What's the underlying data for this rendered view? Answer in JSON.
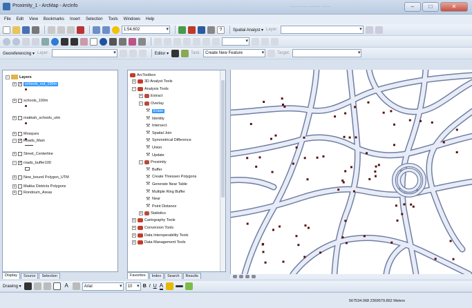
{
  "window": {
    "title": "Proximity_1 - ArcMap - ArcInfo",
    "minimize": "–",
    "maximize": "□",
    "close": "✕",
    "blurred_tabs": "....... ....... .......... ........"
  },
  "menu": [
    "File",
    "Edit",
    "View",
    "Bookmarks",
    "Insert",
    "Selection",
    "Tools",
    "Windows",
    "Help"
  ],
  "toolbar1": {
    "scale": "1:54,602",
    "spatial_analyst": "Spatial Analyst ▾",
    "layer_combo": ""
  },
  "toolbar3": {
    "georeferencing": "Georeferencing ▾",
    "layer": "Layer:",
    "editor": "Editor ▾",
    "construct": "Create New Feature",
    "task": "Task:",
    "target": "Target:"
  },
  "toc": {
    "title": "Layers",
    "layers": [
      {
        "label": "schools_out_100m",
        "checked": true,
        "selected": true
      },
      {
        "label": "schools_100m",
        "checked": false
      },
      {
        "label": "makkah_schools_utm",
        "checked": false
      },
      {
        "label": "Mosques",
        "checked": false
      },
      {
        "label": "Roads_Main",
        "checked": true
      },
      {
        "label": "Street_Centerline",
        "checked": false
      },
      {
        "label": "roads_buffer100",
        "checked": true
      },
      {
        "label": "New_bound Polygon_UTM",
        "checked": false
      },
      {
        "label": "Makka Districts Polygons",
        "checked": false
      },
      {
        "label": "Rondoum_Areas",
        "checked": false
      }
    ],
    "tabs": [
      "Display",
      "Source",
      "Selection"
    ]
  },
  "toolbox": {
    "title": "ArcToolbox",
    "items": [
      {
        "label": "3D Analyst Tools",
        "kind": "toolbox",
        "indent": 0,
        "exp": "+"
      },
      {
        "label": "Analysis Tools",
        "kind": "toolbox",
        "indent": 0,
        "exp": "−"
      },
      {
        "label": "Extract",
        "kind": "toolset",
        "indent": 1,
        "exp": "+"
      },
      {
        "label": "Overlay",
        "kind": "toolset",
        "indent": 1,
        "exp": "−"
      },
      {
        "label": "Erase",
        "kind": "tool",
        "indent": 2,
        "selected": true
      },
      {
        "label": "Identity",
        "kind": "tool",
        "indent": 2
      },
      {
        "label": "Intersect",
        "kind": "tool",
        "indent": 2
      },
      {
        "label": "Spatial Join",
        "kind": "tool",
        "indent": 2
      },
      {
        "label": "Symmetrical Difference",
        "kind": "tool",
        "indent": 2
      },
      {
        "label": "Union",
        "kind": "tool",
        "indent": 2
      },
      {
        "label": "Update",
        "kind": "tool",
        "indent": 2
      },
      {
        "label": "Proximity",
        "kind": "toolset",
        "indent": 1,
        "exp": "−"
      },
      {
        "label": "Buffer",
        "kind": "tool",
        "indent": 2
      },
      {
        "label": "Create Thiessen Polygons",
        "kind": "tool",
        "indent": 2
      },
      {
        "label": "Generate Near Table",
        "kind": "tool",
        "indent": 2
      },
      {
        "label": "Multiple Ring Buffer",
        "kind": "tool",
        "indent": 2
      },
      {
        "label": "Near",
        "kind": "tool",
        "indent": 2
      },
      {
        "label": "Point Distance",
        "kind": "tool",
        "indent": 2
      },
      {
        "label": "Statistics",
        "kind": "toolset",
        "indent": 1,
        "exp": "+"
      },
      {
        "label": "Cartography Tools",
        "kind": "toolbox",
        "indent": 0,
        "exp": "+"
      },
      {
        "label": "Conversion Tools",
        "kind": "toolbox",
        "indent": 0,
        "exp": "+"
      },
      {
        "label": "Data Interoperability Tools",
        "kind": "toolbox",
        "indent": 0,
        "exp": "+"
      },
      {
        "label": "Data Management Tools",
        "kind": "toolbox",
        "indent": 0,
        "exp": "+"
      }
    ],
    "tabs": [
      "Favorites",
      "Index",
      "Search",
      "Results"
    ]
  },
  "drawing": {
    "label": "Drawing ▾",
    "font": "Arial",
    "size": "10",
    "bold": "B",
    "italic": "I",
    "underline": "U",
    "text_a": "A"
  },
  "status": {
    "coords": "567534.068  2369579.862 Meters"
  },
  "colors": {
    "road_casing": "#6f7ea3",
    "road_fill": "#e8ecf7",
    "school_point": "#5a1010",
    "select_blue": "#3399ff"
  }
}
